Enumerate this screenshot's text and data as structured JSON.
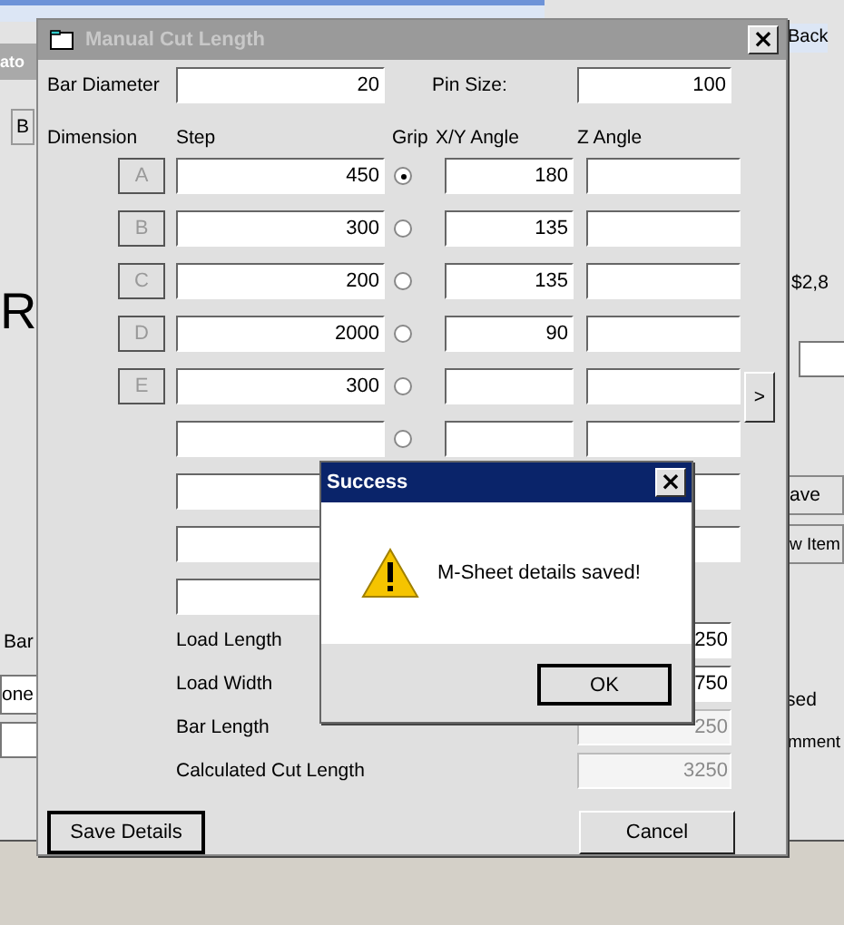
{
  "background_app": {
    "cell_fragment": "Back",
    "title_fragment": "ato",
    "button_fragment": "B",
    "big_letter": "R",
    "price_fragment": "$2,8",
    "save_fragment": "ave",
    "new_item_fragment": "w Item",
    "bar_fragment": "Bar",
    "dropdown_fragment": "one",
    "status_fragment": "sed",
    "comment_fragment": "mment"
  },
  "dialog": {
    "title": "Manual Cut Length",
    "close": "×",
    "bar_diameter": {
      "label": "Bar Diameter",
      "value": "20"
    },
    "pin_size": {
      "label": "Pin Size:",
      "value": "100"
    },
    "headers": [
      "Dimension",
      "Step",
      "Grip",
      "X/Y Angle",
      "Z Angle"
    ],
    "rows": [
      {
        "letter": "A",
        "step": "450",
        "selected": true,
        "xy": "180",
        "z": "",
        "kind": "full"
      },
      {
        "letter": "B",
        "step": "300",
        "selected": false,
        "xy": "135",
        "z": "",
        "kind": "full"
      },
      {
        "letter": "C",
        "step": "200",
        "selected": false,
        "xy": "135",
        "z": "",
        "kind": "full"
      },
      {
        "letter": "D",
        "step": "2000",
        "selected": false,
        "xy": "90",
        "z": "",
        "kind": "full"
      },
      {
        "letter": "E",
        "step": "300",
        "selected": false,
        "xy": "",
        "z": "",
        "kind": "full"
      },
      {
        "step": "",
        "selected": false,
        "xy": "",
        "z": "",
        "kind": "full"
      },
      {
        "step": "",
        "z": "",
        "kind": "covered"
      },
      {
        "step": "",
        "z": "",
        "kind": "covered"
      },
      {
        "step": "",
        "kind": "covered"
      }
    ],
    "next_button": ">",
    "totals": [
      {
        "label": "Load Length",
        "value": "250",
        "disabled": false
      },
      {
        "label": "Load Width",
        "value": "750",
        "disabled": false
      },
      {
        "label": "Bar Length",
        "value": "250",
        "disabled": true
      },
      {
        "label": "Calculated Cut Length",
        "value": "3250",
        "disabled": true
      }
    ],
    "save_button": "Save Details",
    "cancel_button": "Cancel"
  },
  "message_box": {
    "title": "Success",
    "close": "×",
    "message": "M-Sheet details saved!",
    "ok_button": "OK"
  }
}
